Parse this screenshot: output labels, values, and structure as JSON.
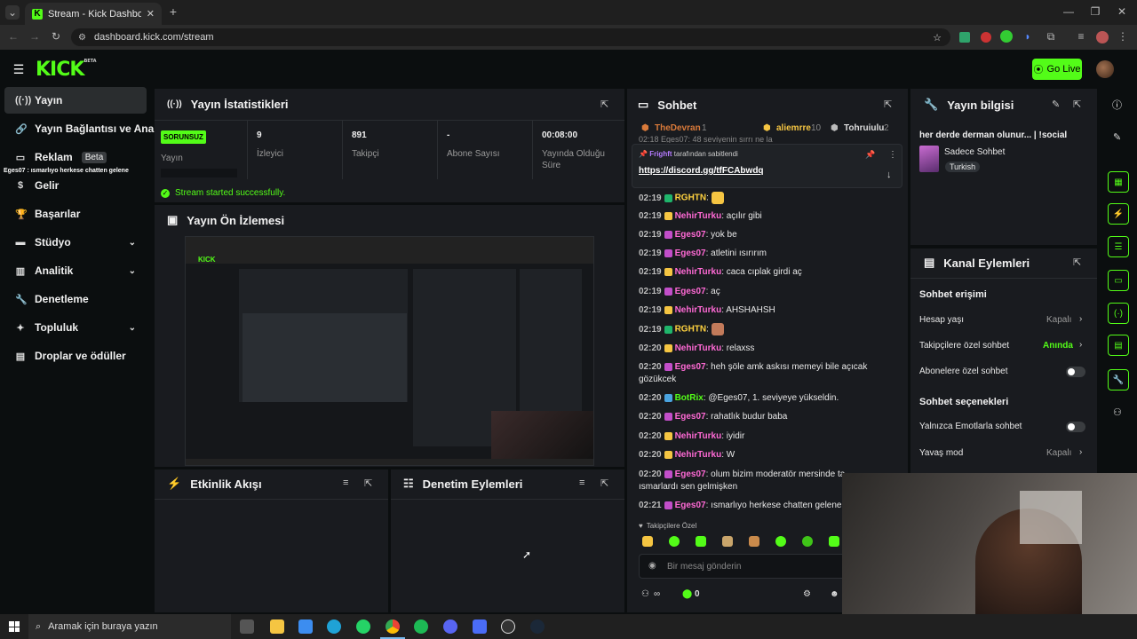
{
  "browser": {
    "tab_title": "Stream - Kick Dashboard",
    "url": "dashboard.kick.com/stream"
  },
  "header": {
    "logo": "KICK",
    "logo_sup": "BETA",
    "go_live_label": "Go Live"
  },
  "sidebar": {
    "items": [
      {
        "label": "Yayın"
      },
      {
        "label": "Yayın Bağlantısı ve Anahtarı"
      },
      {
        "label": "Reklam",
        "badge": "Beta"
      },
      {
        "label": "Gelir"
      },
      {
        "label": "Başarılar"
      },
      {
        "label": "Stüdyo"
      },
      {
        "label": "Analitik"
      },
      {
        "label": "Denetleme"
      },
      {
        "label": "Topluluk"
      },
      {
        "label": "Droplar ve ödüller"
      }
    ],
    "overlay_text": "Eges07 : ısmarlıyo herkese chatten gelene"
  },
  "stats": {
    "title": "Yayın İstatistikleri",
    "status_badge": "SORUNSUZ",
    "status_label": "Yayın",
    "viewers_value": "9",
    "viewers_label": "İzleyici",
    "followers_value": "891",
    "followers_label": "Takipçi",
    "subs_value": "-",
    "subs_label": "Abone Sayısı",
    "uptime_value": "00:08:00",
    "uptime_label_1": "Yayında Olduğu",
    "uptime_label_2": "Süre",
    "success_msg": "Stream started successfully."
  },
  "preview": {
    "title": "Yayın Ön İzlemesi"
  },
  "activity": {
    "title": "Etkinlik Akışı"
  },
  "modlog": {
    "title": "Denetim Eylemleri"
  },
  "chat": {
    "title": "Sohbet",
    "top_gifters": [
      {
        "name": "TheDevran",
        "count": "1"
      },
      {
        "name": "aliemrre",
        "count": "10"
      },
      {
        "name": "Tohruiulu",
        "count": "2"
      }
    ],
    "pinned_by": "Frighft",
    "pinned_suffix": "tarafından sabitlendi",
    "pinned_link": "https://discord.gg/tfFCAbwdq",
    "hidden_line": "02:18 Eges07: 48 seviyenin sırrı ne la",
    "messages": [
      {
        "time": "02:19",
        "user": "RGHTN",
        "text": "",
        "color": "#ffd23f"
      },
      {
        "time": "02:19",
        "user": "NehirTurku",
        "text": "açılır gibi",
        "color": "#ff6ad5"
      },
      {
        "time": "02:19",
        "user": "Eges07",
        "text": "yok be",
        "color": "#ff6ad5"
      },
      {
        "time": "02:19",
        "user": "Eges07",
        "text": "atletini ısırırım",
        "color": "#ff6ad5"
      },
      {
        "time": "02:19",
        "user": "NehirTurku",
        "text": "caca cıplak girdi aç",
        "color": "#ff6ad5"
      },
      {
        "time": "02:19",
        "user": "Eges07",
        "text": "aç",
        "color": "#ff6ad5"
      },
      {
        "time": "02:19",
        "user": "NehirTurku",
        "text": "AHSHAHSH",
        "color": "#ff6ad5"
      },
      {
        "time": "02:19",
        "user": "RGHTN",
        "text": "",
        "color": "#ffd23f"
      },
      {
        "time": "02:20",
        "user": "NehirTurku",
        "text": "relaxss",
        "color": "#ff6ad5"
      },
      {
        "time": "02:20",
        "user": "Eges07",
        "text": "heh şöle amk askısı memeyi bile açıcak gözükcek",
        "color": "#ff6ad5"
      },
      {
        "time": "02:20",
        "user": "BotRix",
        "text": "@Eges07, 1. seviyeye yükseldin.",
        "color": "#53fc18"
      },
      {
        "time": "02:20",
        "user": "Eges07",
        "text": "rahatlık budur baba",
        "color": "#ff6ad5"
      },
      {
        "time": "02:20",
        "user": "NehirTurku",
        "text": "iyidir",
        "color": "#ff6ad5"
      },
      {
        "time": "02:20",
        "user": "NehirTurku",
        "text": "W",
        "color": "#ff6ad5"
      },
      {
        "time": "02:20",
        "user": "Eges07",
        "text": "olum bizim moderatör mersinde ta... ısmarlardı sen gelmişken",
        "color": "#ff6ad5"
      },
      {
        "time": "02:21",
        "user": "Eges07",
        "text": "ısmarlıyo herkese chatten gelene",
        "color": "#ff6ad5"
      }
    ],
    "followers_only_label": "Takipçilere Özel",
    "input_placeholder": "Bir mesaj gönderin",
    "infinity": "∞",
    "points": "0"
  },
  "stream_info": {
    "title": "Yayın bilgisi",
    "stream_title": "her derde derman olunur... | !social",
    "category_label": "Sadece Sohbet",
    "tag": "Turkish"
  },
  "channel_actions": {
    "title": "Kanal Eylemleri",
    "access_heading": "Sohbet erişimi",
    "account_age_label": "Hesap yaşı",
    "account_age_value": "Kapalı",
    "followers_chat_label": "Takipçilere özel sohbet",
    "followers_chat_value": "Anında",
    "subs_chat_label": "Abonelere özel sohbet",
    "options_heading": "Sohbet seçenekleri",
    "emote_only_label": "Yalnızca Emotlarla sohbet",
    "slow_mode_label": "Yavaş mod",
    "slow_mode_value": "Kapalı"
  },
  "taskbar": {
    "search_placeholder": "Aramak için buraya yazın"
  },
  "colors": {
    "accent": "#53fc18",
    "panel": "#191b1f",
    "background": "#0b0e0f",
    "subscriber_pink": "#ff6ad5"
  }
}
